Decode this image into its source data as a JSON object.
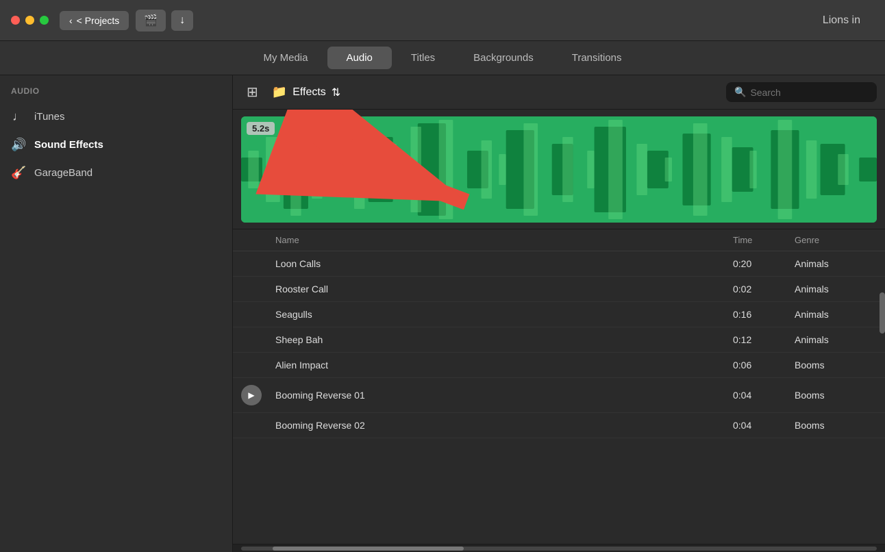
{
  "titlebar": {
    "projects_label": "< Projects",
    "title": "Lions in"
  },
  "nav": {
    "tabs": [
      {
        "id": "my-media",
        "label": "My Media"
      },
      {
        "id": "audio",
        "label": "Audio",
        "active": true
      },
      {
        "id": "titles",
        "label": "Titles"
      },
      {
        "id": "backgrounds",
        "label": "Backgrounds"
      },
      {
        "id": "transitions",
        "label": "Transitions"
      }
    ]
  },
  "sidebar": {
    "section_label": "AUDIO",
    "items": [
      {
        "id": "itunes",
        "label": "iTunes",
        "icon": "♩"
      },
      {
        "id": "sound-effects",
        "label": "Sound Effects",
        "icon": "🔊",
        "active": true
      },
      {
        "id": "garageband",
        "label": "GarageBand",
        "icon": "🎸"
      }
    ]
  },
  "content": {
    "folder_name": "Effects",
    "search_placeholder": "Search",
    "waveform_time": "5.2s",
    "table": {
      "headers": [
        "",
        "Name",
        "Time",
        "Genre"
      ],
      "rows": [
        {
          "play": false,
          "name": "Loon Calls",
          "time": "0:20",
          "genre": "Animals"
        },
        {
          "play": false,
          "name": "Rooster Call",
          "time": "0:02",
          "genre": "Animals"
        },
        {
          "play": false,
          "name": "Seagulls",
          "time": "0:16",
          "genre": "Animals"
        },
        {
          "play": false,
          "name": "Sheep Bah",
          "time": "0:12",
          "genre": "Animals"
        },
        {
          "play": false,
          "name": "Alien Impact",
          "time": "0:06",
          "genre": "Booms"
        },
        {
          "play": true,
          "name": "Booming Reverse 01",
          "time": "0:04",
          "genre": "Booms"
        },
        {
          "play": false,
          "name": "Booming Reverse 02",
          "time": "0:04",
          "genre": "Booms"
        }
      ]
    }
  }
}
